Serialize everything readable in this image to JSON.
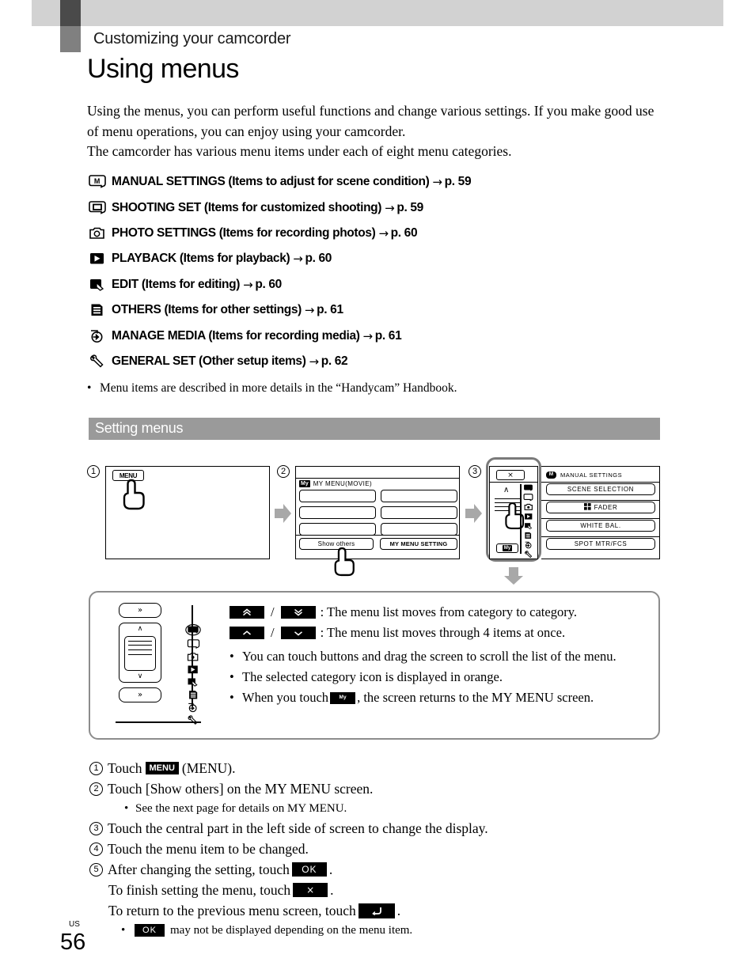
{
  "header": {
    "chapter": "Customizing your camcorder",
    "title": "Using menus"
  },
  "intro": {
    "line1": "Using the menus, you can perform useful functions and change various settings. If you make good use of menu operations, you can enjoy using your camcorder.",
    "line2": "The camcorder has various menu items under each of eight menu categories."
  },
  "categories": [
    {
      "icon": "manual-settings-icon",
      "label": "MANUAL SETTINGS (Items to adjust for scene condition)",
      "arrow": "→",
      "page": "p. 59"
    },
    {
      "icon": "shooting-set-icon",
      "label": "SHOOTING SET (Items for customized shooting)",
      "arrow": "→",
      "page": "p. 59"
    },
    {
      "icon": "photo-settings-icon",
      "label": "PHOTO SETTINGS (Items for recording photos)",
      "arrow": "→",
      "page": "p. 60"
    },
    {
      "icon": "playback-icon",
      "label": "PLAYBACK (Items for playback)",
      "arrow": "→",
      "page": "p. 60"
    },
    {
      "icon": "edit-icon",
      "label": "EDIT (Items for editing)",
      "arrow": "→",
      "page": "p. 60"
    },
    {
      "icon": "others-icon",
      "label": "OTHERS (Items for other settings)",
      "arrow": "→",
      "page": "p. 61"
    },
    {
      "icon": "manage-media-icon",
      "label": "MANAGE MEDIA (Items for recording media)",
      "arrow": "→",
      "page": "p. 61"
    },
    {
      "icon": "general-set-icon",
      "label": "GENERAL SET (Other setup items)",
      "arrow": "→",
      "page": "p. 62"
    }
  ],
  "handbook_note": "Menu items are described in more details in the “Handycam” Handbook.",
  "section": {
    "title": "Setting menus"
  },
  "diagram": {
    "step1_num": "1",
    "step2_num": "2",
    "step3_num": "3",
    "screen1": {
      "menu_button": "MENU"
    },
    "screen2": {
      "my_badge": "My",
      "title": "MY MENU(MOVIE)",
      "show_others": "Show others",
      "my_menu_setting": "MY MENU SETTING"
    },
    "screen3": {
      "close": "×",
      "my_badge": "My",
      "caret_up": "∧",
      "category_badge": "M",
      "category_title": "MANUAL SETTINGS",
      "items": [
        {
          "label": "SCENE SELECTION",
          "has_icon": false
        },
        {
          "label": "FADER",
          "has_icon": true
        },
        {
          "label": "WHITE BAL.",
          "has_icon": false
        },
        {
          "label": "SPOT MTR/FCS",
          "has_icon": false
        }
      ]
    }
  },
  "callout": {
    "row1": {
      "btn_a": "»",
      "slash": "/",
      "btn_b": "»",
      "text": ": The menu list moves from category to category."
    },
    "row2": {
      "btn_a": "∧",
      "slash": "/",
      "btn_b": "∨",
      "text": ": The menu list moves through 4 items at once."
    },
    "bullets": [
      {
        "text": "You can touch buttons and drag the screen to scroll the list of the menu."
      },
      {
        "text": "The selected category icon is displayed in orange."
      },
      {
        "pre": "When you touch",
        "badge": "My",
        "post": ", the screen returns to the MY MENU screen."
      }
    ],
    "panel": {
      "top_btn": "»",
      "up": "∧",
      "down": "∨",
      "bottom_btn": "»"
    }
  },
  "steps": [
    {
      "num": "1",
      "pre": "Touch",
      "badge": "MENU",
      "post": "(MENU)."
    },
    {
      "num": "2",
      "pre": "Touch [Show others] on the MY MENU screen.",
      "sub": "See the next page for details on MY MENU."
    },
    {
      "num": "3",
      "pre": "Touch the central part in the left side of screen to change the display."
    },
    {
      "num": "4",
      "pre": "Touch the menu item to be changed."
    },
    {
      "num": "5",
      "pre": "After changing the setting, touch",
      "badge": "OK",
      "post": "."
    }
  ],
  "step5_lines": {
    "line2_pre": "To finish setting the menu, touch",
    "line2_badge": "×",
    "line2_post": ".",
    "line3_pre": "To return to the previous menu screen, touch",
    "line3_badge": "↩",
    "line3_post": ".",
    "line4_badge": "OK",
    "line4_post": "may not be displayed depending on the menu item."
  },
  "footer": {
    "region": "US",
    "page": "56"
  },
  "colors": {
    "band_light": "#d2d2d2",
    "band_dark": "#4a4a4a",
    "band_mid": "#808080",
    "section_bar": "#9a9a9a",
    "callout_border": "#8c8c8c",
    "arrow_gray": "#a8a8a8"
  }
}
